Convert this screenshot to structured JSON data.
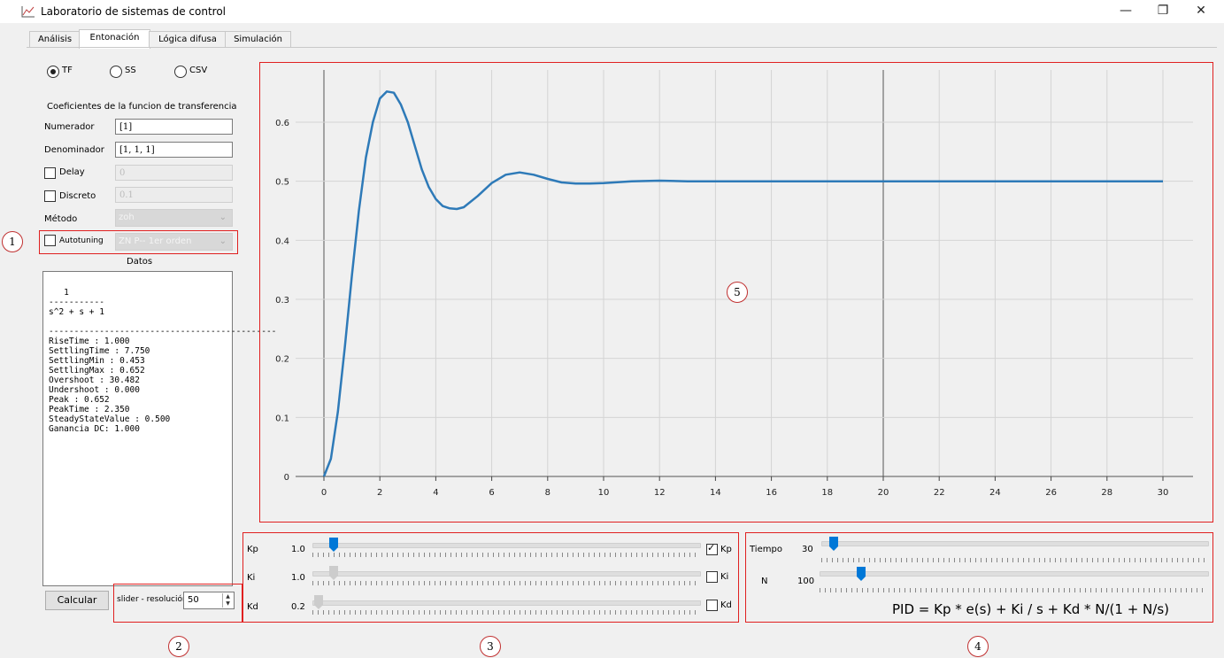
{
  "window": {
    "title": "Laboratorio de sistemas de control",
    "minimize": "—",
    "restore": "❐",
    "close": "✕"
  },
  "tabs": [
    "Análisis",
    "Entonación",
    "Lógica difusa",
    "Simulación"
  ],
  "active_tab": "Entonación",
  "input_type": {
    "options": [
      "TF",
      "SS",
      "CSV"
    ],
    "selected": "TF"
  },
  "tf": {
    "heading": "Coeficientes de la funcion de transferencia",
    "numerador_label": "Numerador",
    "numerador_value": "[1]",
    "denominador_label": "Denominador",
    "denominador_value": "[1, 1, 1]",
    "delay_label": "Delay",
    "delay_value": "0",
    "discreto_label": "Discreto",
    "discreto_value": "0.1",
    "metodo_label": "Método",
    "metodo_value": "zoh",
    "autotuning_label": "Autotuning",
    "autotuning_value": "ZN P-- 1er orden"
  },
  "datos": {
    "heading": "Datos",
    "text": "   1\n-----------\ns^2 + s + 1\n\n---------------------------------------------\nRiseTime : 1.000\nSettlingTime : 7.750\nSettlingMin : 0.453\nSettlingMax : 0.652\nOvershoot : 30.482\nUndershoot : 0.000\nPeak : 0.652\nPeakTime : 2.350\nSteadyStateValue : 0.500\nGanancia DC: 1.000"
  },
  "calcular_label": "Calcular",
  "slider_res": {
    "label": "slider - resolución",
    "value": "50"
  },
  "gains": [
    {
      "label": "Kp",
      "value": "1.0",
      "check_label": "Kp",
      "checked": true,
      "level": 0.04
    },
    {
      "label": "Ki",
      "value": "1.0",
      "check_label": "Ki",
      "checked": false,
      "level": 0.04
    },
    {
      "label": "Kd",
      "value": "0.2",
      "check_label": "Kd",
      "checked": false,
      "level": 0.0
    }
  ],
  "tiempo": {
    "label": "Tiempo",
    "value": "30",
    "level": 0.03
  },
  "n_param": {
    "label": "N",
    "value": "100",
    "level": 0.11
  },
  "pid_formula": "PID = Kp * e(s) + Ki / s + Kd * N/(1 + N/s)",
  "markers": [
    "1",
    "2",
    "3",
    "4",
    "5"
  ],
  "colors": {
    "series": "#2e7ab8",
    "annotation": "#e02020",
    "slider_active": "#0078d7"
  },
  "chart_data": {
    "type": "line",
    "title": "",
    "xlabel": "",
    "ylabel": "",
    "xlim": [
      0,
      30
    ],
    "ylim": [
      0,
      0.65
    ],
    "xticks": [
      0,
      2,
      4,
      6,
      8,
      10,
      12,
      14,
      16,
      18,
      20,
      22,
      24,
      26,
      28,
      30
    ],
    "yticks": [
      0,
      0.1,
      0.2,
      0.3,
      0.4,
      0.5,
      0.6
    ],
    "grid": true,
    "series": [
      {
        "x": [
          0,
          0.25,
          0.5,
          0.75,
          1.0,
          1.25,
          1.5,
          1.75,
          2.0,
          2.25,
          2.5,
          2.75,
          3.0,
          3.25,
          3.5,
          3.75,
          4.0,
          4.25,
          4.5,
          4.75,
          5.0,
          5.5,
          6.0,
          6.5,
          7.0,
          7.5,
          8.0,
          8.5,
          9.0,
          9.5,
          10.0,
          11.0,
          12.0,
          13.0,
          14.0,
          16.0,
          20.0,
          25.0,
          30.0
        ],
        "y": [
          0,
          0.03,
          0.11,
          0.22,
          0.34,
          0.45,
          0.54,
          0.6,
          0.64,
          0.652,
          0.65,
          0.63,
          0.6,
          0.56,
          0.52,
          0.49,
          0.47,
          0.458,
          0.454,
          0.453,
          0.456,
          0.475,
          0.497,
          0.511,
          0.515,
          0.511,
          0.504,
          0.498,
          0.496,
          0.496,
          0.497,
          0.5,
          0.501,
          0.5,
          0.5,
          0.5,
          0.5,
          0.5,
          0.5
        ]
      }
    ]
  }
}
